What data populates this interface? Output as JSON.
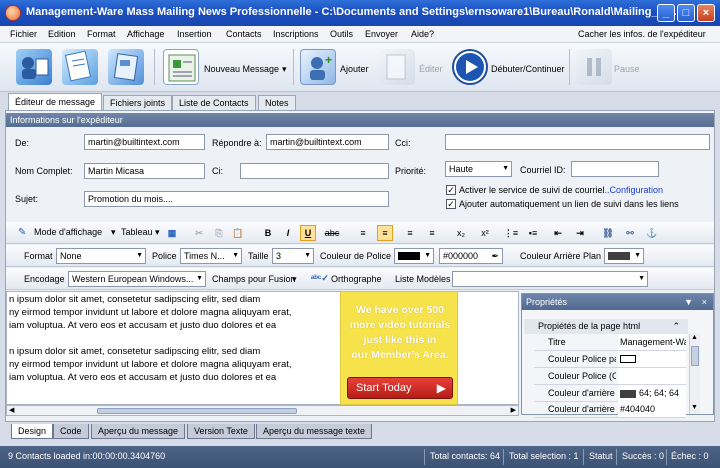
{
  "window": {
    "title": "Management-Ware Mass Mailing News Professionnelle - C:\\Documents and Settings\\ernsoware1\\Bureau\\Ronald\\Mailing_Lis..."
  },
  "menu": {
    "items": [
      "Fichier",
      "Edition",
      "Format",
      "Affichage",
      "Insertion",
      "Contacts",
      "Inscriptions",
      "Outils",
      "Envoyer",
      "Aide?"
    ],
    "right_link": "Cacher les infos. de l'expéditeur"
  },
  "toolbar": {
    "new_message": "Nouveau Message",
    "add": "Ajouter",
    "edit": "Éditer",
    "start_continue": "Débuter/Continuer",
    "pause": "Pause"
  },
  "tabs": [
    "Éditeur de message",
    "Fichiers joints",
    "Liste de Contacts",
    "Notes"
  ],
  "sender": {
    "header": "Informations sur l'expéditeur",
    "from_label": "De:",
    "from_value": "martin@builtintext.com",
    "reply_label": "Répondre à:",
    "reply_value": "martin@builtintext.com",
    "cc_label": "Cci:",
    "cc_value": "",
    "fullname_label": "Nom Complet:",
    "fullname_value": "Martin Micasa",
    "ci_label": "Ci:",
    "ci_value": "",
    "priority_label": "Priorité:",
    "priority_value": "Haute",
    "courriel_id_label": "Courriel ID:",
    "courriel_id_value": "",
    "subject_label": "Sujet:",
    "subject_value": "Promotion du mois....",
    "tracking_label": "Activer le service de suivi de courriel",
    "tracking_link": "...Configuration",
    "auto_link_label": "Ajouter automatiquement un lien de suivi dans les liens"
  },
  "editor_toolbar": {
    "view_mode": "Mode d'affichage",
    "table": "Tableau",
    "format_label": "Format",
    "format_value": "None",
    "font_label": "Police",
    "font_value": "Times N...",
    "size_label": "Taille",
    "size_value": "3",
    "font_color_label": "Couleur de Police",
    "font_color_hex": "#000000",
    "bg_color_label": "Couleur Arrière Plan",
    "encoding_label": "Encodage",
    "encoding_value": "Western European Windows...",
    "merge_fields": "Champs pour Fusion",
    "spelling": "Orthographe",
    "templates_label": "Liste Modèles",
    "templates_value": ""
  },
  "editor": {
    "lines": [
      "n ipsum dolor sit amet, consetetur sadipscing elitr, sed diam",
      "ny eirmod tempor invidunt ut labore et dolore magna aliquyam erat,",
      "iam voluptua. At vero eos et accusam et justo duo dolores et ea",
      "n ipsum dolor sit amet, consetetur sadipscing elitr, sed diam",
      "ny eirmod tempor invidunt ut labore et dolore magna aliquyam erat,",
      "iam voluptua. At vero eos et accusam et justo duo dolores et ea"
    ]
  },
  "promo": {
    "lines": [
      "We have over 500",
      "more video tutorials",
      "just like this in",
      "our Member's Area."
    ],
    "button": "Start Today"
  },
  "properties": {
    "title": "Propriétés",
    "section": "Propiétés de la page html",
    "rows": [
      {
        "key": "Titre",
        "value": "Management-Wa"
      },
      {
        "key": "Couleur Police pa",
        "value": ""
      },
      {
        "key": "Couleur Police (C",
        "value": ""
      },
      {
        "key": "Couleur d'arrière",
        "value": "64; 64; 64"
      },
      {
        "key": "Couleur d'arrière",
        "value": "#404040"
      }
    ]
  },
  "bottom_tabs": [
    "Design",
    "Code",
    "Aperçu du message",
    "Version Texte",
    "Aperçu du message texte"
  ],
  "status": {
    "loaded": "9 Contacts loaded in:00:00:00.3404760",
    "total_contacts": "Total contacts: 64",
    "total_selection": "Total selection : 1",
    "statut": "Statut",
    "success": "Succès : 0",
    "failure": "Échec : 0"
  },
  "colors": {
    "titlebar": "#1b4fc0",
    "accent_yellow": "#f6e24a",
    "start_red": "#c8251e",
    "statusbar": "#44597c"
  }
}
